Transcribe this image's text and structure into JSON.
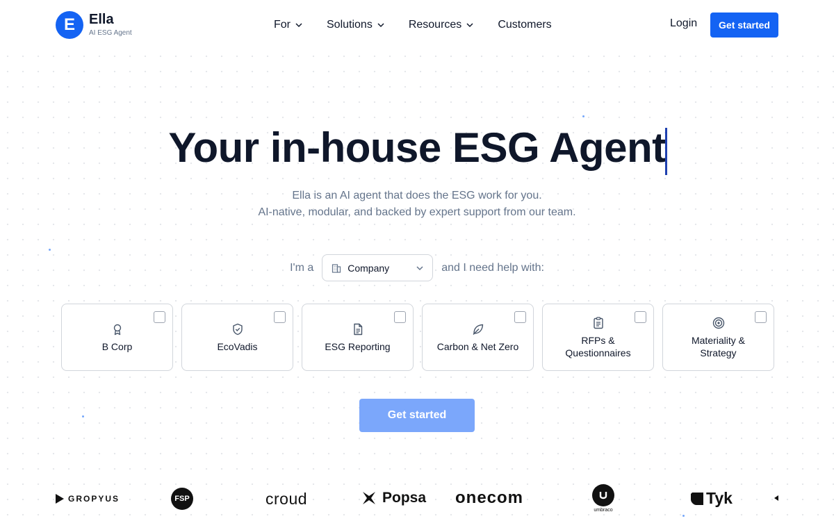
{
  "brand": {
    "name": "Ella",
    "tagline": "AI ESG Agent",
    "mark": "E",
    "color": "#1463f3"
  },
  "nav": {
    "items": [
      {
        "label": "For",
        "dropdown": true
      },
      {
        "label": "Solutions",
        "dropdown": true
      },
      {
        "label": "Resources",
        "dropdown": true
      },
      {
        "label": "Customers",
        "dropdown": false
      }
    ],
    "login_label": "Login",
    "cta_label": "Get started"
  },
  "hero": {
    "title": "Your in-house ESG Agent",
    "subtitle_line1": "Ella is an AI agent that does the ESG work for you.",
    "subtitle_line2": "AI-native, modular, and backed by expert support from our team."
  },
  "selector": {
    "prefix": "I'm a",
    "selected": "Company",
    "suffix": "and I need help with:",
    "icon": "building-icon"
  },
  "cards": [
    {
      "label": "B Corp",
      "icon": "award-icon",
      "checked": false
    },
    {
      "label": "EcoVadis",
      "icon": "shield-check-icon",
      "checked": false
    },
    {
      "label": "ESG Reporting",
      "icon": "document-icon",
      "checked": false
    },
    {
      "label": "Carbon & Net Zero",
      "icon": "leaf-icon",
      "checked": false
    },
    {
      "label": "RFPs & Questionnaires",
      "icon": "clipboard-icon",
      "checked": false
    },
    {
      "label": "Materiality & Strategy",
      "icon": "target-icon",
      "checked": false
    }
  ],
  "main_cta_label": "Get started",
  "customer_logos": [
    "GROPYUS",
    "FSP",
    "croud",
    "Popsa",
    "onecom",
    "umbraco",
    "Tyk"
  ]
}
